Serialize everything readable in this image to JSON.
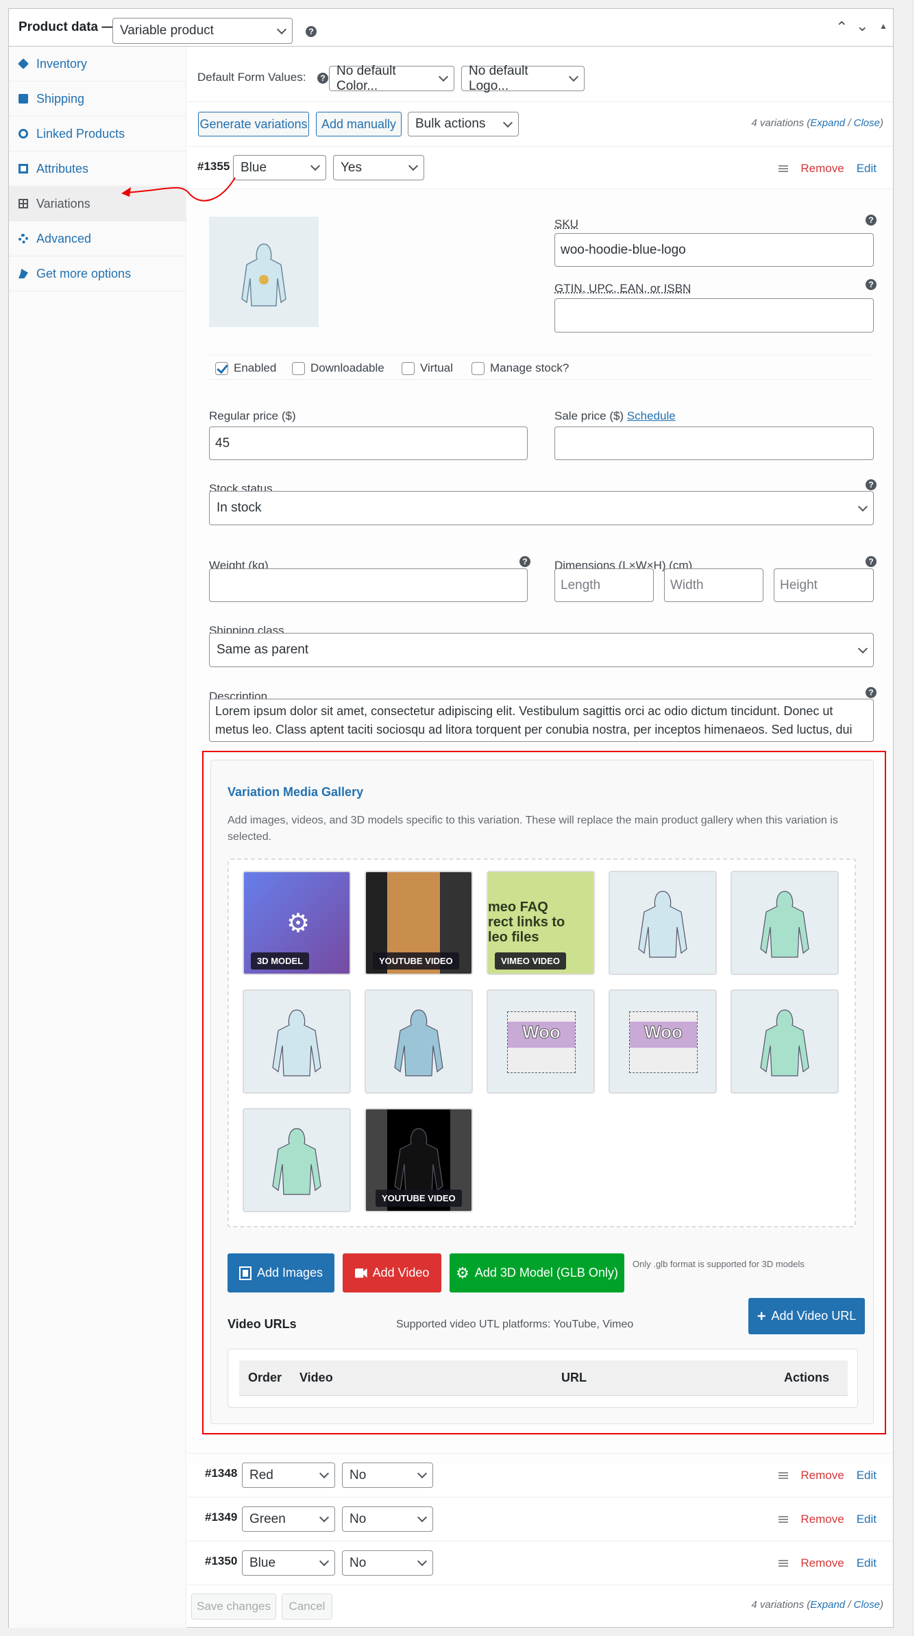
{
  "header": {
    "title": "Product data —",
    "product_type": "Variable product"
  },
  "sidebar": {
    "items": [
      {
        "label": "Inventory",
        "icon": "tag-icon"
      },
      {
        "label": "Shipping",
        "icon": "truck-icon"
      },
      {
        "label": "Linked Products",
        "icon": "link-icon"
      },
      {
        "label": "Attributes",
        "icon": "list-icon"
      },
      {
        "label": "Variations",
        "icon": "grid-icon"
      },
      {
        "label": "Advanced",
        "icon": "gear-icon"
      },
      {
        "label": "Get more options",
        "icon": "plugin-icon"
      }
    ]
  },
  "defaults": {
    "label": "Default Form Values:",
    "color": "No default Color...",
    "logo": "No default Logo..."
  },
  "toolbar": {
    "generate": "Generate variations",
    "add_manually": "Add manually",
    "bulk": "Bulk actions",
    "count": "4 variations (",
    "expand": "Expand",
    "sep": " / ",
    "close": "Close",
    ")": ")"
  },
  "variation": {
    "id": "#1355",
    "color": "Blue",
    "logo": "Yes",
    "remove": "Remove",
    "edit": "Edit",
    "sku_label": "SKU",
    "sku": "woo-hoodie-blue-logo",
    "gtin_label": "GTIN, UPC, EAN, or ISBN",
    "enabled": "Enabled",
    "downloadable": "Downloadable",
    "virtual": "Virtual",
    "manage_stock": "Manage stock?",
    "regular_label": "Regular price ($)",
    "regular": "45",
    "sale_label": "Sale price ($)",
    "schedule": "Schedule",
    "stock_label": "Stock status",
    "stock": "In stock",
    "weight_label": "Weight (kg)",
    "dims_label": "Dimensions (L×W×H) (cm)",
    "length": "Length",
    "width": "Width",
    "height": "Height",
    "ship_label": "Shipping class",
    "ship": "Same as parent",
    "desc_label": "Description",
    "desc": "Lorem ipsum dolor sit amet, consectetur adipiscing elit. Vestibulum sagittis orci ac odio dictum tincidunt. Donec ut metus leo. Class aptent taciti sociosqu ad litora torquent per conubia nostra, per inceptos himenaeos. Sed luctus, dui eu sagittis"
  },
  "gallery": {
    "title": "Variation Media Gallery",
    "desc": "Add images, videos, and 3D models specific to this variation. These will replace the main product gallery when this variation is selected.",
    "items": [
      {
        "badge": "3D MODEL"
      },
      {
        "badge": "YOUTUBE VIDEO"
      },
      {
        "badge": "VIMEO VIDEO",
        "text": "meo FAQ\nrect links to\nleo files"
      },
      {},
      {},
      {},
      {},
      {
        "text": "Woo"
      },
      {
        "text": "Woo"
      },
      {},
      {},
      {
        "badge": "YOUTUBE VIDEO"
      }
    ],
    "add_images": "Add Images",
    "add_video": "Add Video",
    "add_3d": "Add 3D Model (GLB Only)",
    "note": "Only .glb format is supported for 3D models",
    "video_urls": "Video URLs",
    "platforms": "Supported video UTL platforms: YouTube, Vimeo",
    "add_url": "Add Video URL",
    "columns": [
      "Order",
      "Video",
      "URL",
      "Actions"
    ],
    "colors": {
      "blue": "#2271b1",
      "red": "#dc3232",
      "green": "#00a32a"
    }
  },
  "rows": [
    {
      "id": "#1348",
      "color": "Red",
      "logo": "No"
    },
    {
      "id": "#1349",
      "color": "Green",
      "logo": "No"
    },
    {
      "id": "#1350",
      "color": "Blue",
      "logo": "No"
    }
  ],
  "footer": {
    "save": "Save changes",
    "cancel": "Cancel"
  }
}
